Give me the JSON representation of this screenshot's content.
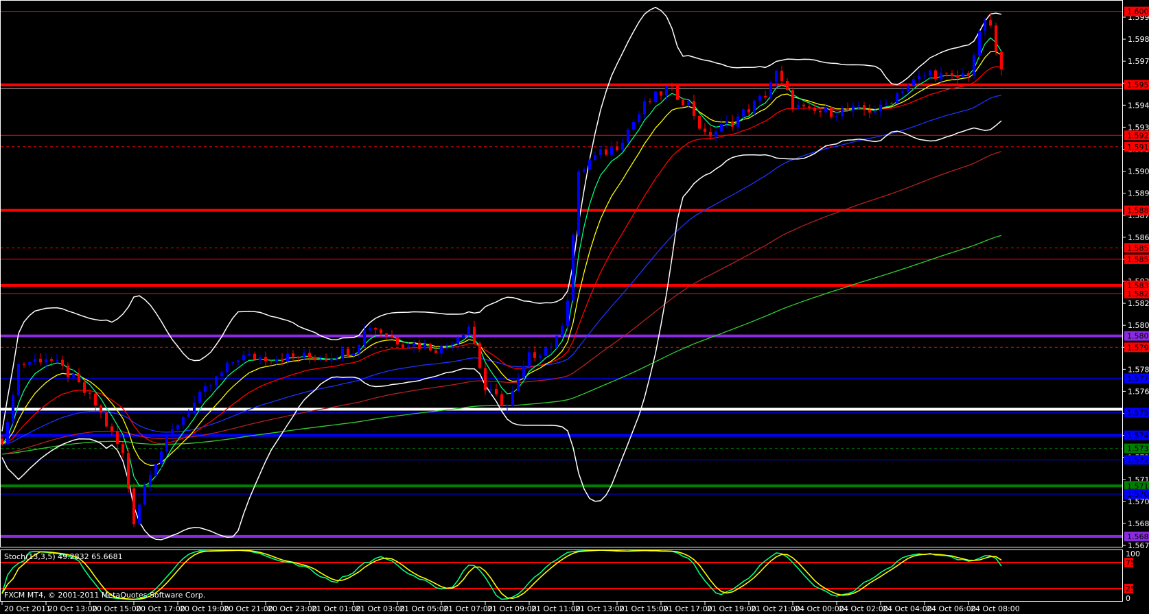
{
  "chart_data": {
    "type": "candlestick",
    "symbol_note": "",
    "bar_interval_hours": 0.25,
    "price_path": {
      "t_hours": [
        0.17,
        0.67,
        2,
        3,
        4.3,
        5.5,
        6,
        6.7,
        8,
        9.3,
        10.7,
        13.3,
        14.7,
        16,
        16.7,
        18,
        20,
        21.3,
        22,
        23,
        24,
        25.3,
        25.8,
        26.2,
        26.7,
        28,
        29.3,
        30.3,
        31.3,
        32,
        33.3,
        34.7,
        35.2,
        36,
        36.7,
        40,
        41,
        42.3,
        43.3,
        44,
        44.8,
        45.3,
        45.7
      ],
      "price": [
        1.574,
        1.5785,
        1.579,
        1.578,
        1.576,
        1.573,
        1.569,
        1.572,
        1.575,
        1.577,
        1.579,
        1.579,
        1.579,
        1.5795,
        1.581,
        1.58,
        1.5795,
        1.581,
        1.577,
        1.576,
        1.579,
        1.58,
        1.583,
        1.59,
        1.591,
        1.592,
        1.5945,
        1.5955,
        1.5945,
        1.5925,
        1.5935,
        1.595,
        1.5965,
        1.5945,
        1.594,
        1.5942,
        1.5955,
        1.5965,
        1.596,
        1.5965,
        1.6,
        1.5975,
        1.5955
      ]
    },
    "ylim": [
      1.56745,
      1.59985
    ],
    "price_ticks": [
      "1.59985",
      "1.59850",
      "1.59715",
      "1.59580",
      "1.59445",
      "1.59310",
      "1.59175",
      "1.59040",
      "1.58905",
      "1.58770",
      "1.58635",
      "1.58500",
      "1.58365",
      "1.58230",
      "1.58095",
      "1.57960",
      "1.57825",
      "1.57690",
      "1.57555",
      "1.57420",
      "1.57285",
      "1.57150",
      "1.57015",
      "1.56880",
      "1.56745"
    ],
    "time_labels": [
      "20 Oct 2011",
      "20 Oct 13:00",
      "20 Oct 15:00",
      "20 Oct 17:00",
      "20 Oct 19:00",
      "20 Oct 21:00",
      "20 Oct 23:00",
      "21 Oct 01:00",
      "21 Oct 03:00",
      "21 Oct 05:00",
      "21 Oct 07:00",
      "21 Oct 09:00",
      "21 Oct 11:00",
      "21 Oct 13:00",
      "21 Oct 15:00",
      "21 Oct 17:00",
      "21 Oct 19:00",
      "21 Oct 21:00",
      "24 Oct 00:00",
      "24 Oct 02:00",
      "24 Oct 04:00",
      "24 Oct 06:00",
      "24 Oct 08:00"
    ],
    "horizontal_lines": [
      {
        "price": "1.60020",
        "color": "#ff0000",
        "style": "solid",
        "weight": "thin",
        "label": true
      },
      {
        "price": "1.59570",
        "color": "#ff0000",
        "style": "solid",
        "weight": "thick",
        "label": true
      },
      {
        "price": "1.59548",
        "color": "#c0c0c0",
        "style": "solid",
        "weight": "thin",
        "label": false
      },
      {
        "price": "1.59260",
        "color": "#ff0000",
        "style": "solid",
        "weight": "thin",
        "label": true
      },
      {
        "price": "1.59190",
        "color": "#ff0000",
        "style": "dashed",
        "weight": "thin",
        "label": true
      },
      {
        "price": "1.58800",
        "color": "#ff0000",
        "style": "solid",
        "weight": "thick",
        "label": true
      },
      {
        "price": "1.58570",
        "color": "#ff0000",
        "style": "dashed",
        "weight": "thin",
        "label": true
      },
      {
        "price": "1.58500",
        "color": "#ff0000",
        "style": "solid",
        "weight": "thin",
        "label": true
      },
      {
        "price": "1.58340",
        "color": "#ff0000",
        "style": "solid",
        "weight": "thick",
        "label": true
      },
      {
        "price": "1.58290",
        "color": "#ff0000",
        "style": "solid",
        "weight": "thin",
        "label": true
      },
      {
        "price": "1.58030",
        "color": "#8a2be2",
        "style": "solid",
        "weight": "thick",
        "label": true
      },
      {
        "price": "1.57960",
        "color": "#ff0000",
        "style": "dashed",
        "weight": "thin",
        "label": true
      },
      {
        "price": "1.57770",
        "color": "#0000ff",
        "style": "solid",
        "weight": "thin",
        "label": true
      },
      {
        "price": "1.57580",
        "color": "#ffffff",
        "style": "solid",
        "weight": "thick",
        "label": false
      },
      {
        "price": "1.57560",
        "color": "#0000ff",
        "style": "solid",
        "weight": "thin",
        "label": true
      },
      {
        "price": "1.57420",
        "color": "#0000ff",
        "style": "solid",
        "weight": "thick",
        "label": true
      },
      {
        "price": "1.57340",
        "color": "#008000",
        "style": "dashed",
        "weight": "thin",
        "label": true
      },
      {
        "price": "1.57270",
        "color": "#0000ff",
        "style": "solid",
        "weight": "thin",
        "label": true
      },
      {
        "price": "1.57110",
        "color": "#008000",
        "style": "solid",
        "weight": "thick",
        "label": true
      },
      {
        "price": "1.57060",
        "color": "#0000ff",
        "style": "solid",
        "weight": "thin",
        "label": true
      },
      {
        "price": "1.56800",
        "color": "#8a2be2",
        "style": "solid",
        "weight": "thick",
        "label": true
      }
    ],
    "moving_averages": [
      {
        "name": "ma-5",
        "period": 5,
        "color": "#00ff7f"
      },
      {
        "name": "ma-10",
        "period": 10,
        "color": "#ffff00"
      },
      {
        "name": "ma-21",
        "period": 21,
        "color": "#ff0000"
      },
      {
        "name": "ma-50",
        "period": 50,
        "color": "#1e32ff"
      },
      {
        "name": "ma-100",
        "period": 100,
        "color": "#b22222"
      },
      {
        "name": "ma-200",
        "period": 200,
        "color": "#32cd32"
      }
    ],
    "bollinger": {
      "period": 20,
      "deviations": 2,
      "color": "#ffffff"
    },
    "candle_colors": {
      "bull": "#0000ff",
      "bear": "#ff0000"
    },
    "stochastic": {
      "label": "Stoch(13,3,5) 49.2832 65.6681",
      "k": 13,
      "d": 3,
      "slowing": 5,
      "levels": [
        "75",
        "25"
      ],
      "axis": [
        "100",
        "0"
      ],
      "main_color": "#00ff7f",
      "signal_color": "#ffff00",
      "level_color": "#ff0000"
    }
  },
  "footer": "FXCM MT4, © 2001-2011 MetaQuotes Software Corp."
}
